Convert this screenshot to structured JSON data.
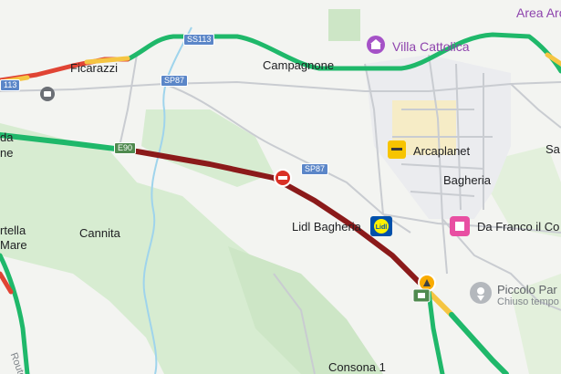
{
  "places": {
    "area_arco": "Area Arc",
    "villa_cattolica": "Villa Cattolica",
    "ficarazzi": "Ficarazzi",
    "campagnone": "Campagnone",
    "arcaplanet": "Arcaplanet",
    "bagheria": "Bagheria",
    "sa": "Sa",
    "cannita": "Cannita",
    "lidl": "Lidl Bagheria",
    "da_franco": "Da Franco il Co",
    "piccolo_par": "Piccolo Par",
    "chiuso": "Chiuso tempo",
    "consona": "Consona 1",
    "edge_top": "da",
    "edge_bottom": "ne",
    "rtella": "rtella",
    "mare": "Mare",
    "route_vertical": "Route"
  },
  "shields": {
    "ss113": "SS113",
    "sp87_top": "SP87",
    "sp87_mid": "SP87",
    "e90": "E90",
    "edge_113": "113"
  },
  "traffic": {
    "colors": {
      "free": "#1fb86a",
      "slow": "#f5c542",
      "jam": "#e04434",
      "heavy": "#8b1a1a"
    }
  },
  "icons": {
    "villa": "landmark-icon",
    "arcaplanet": "shop-icon",
    "lidl": "lidl-logo-icon",
    "da_franco": "restaurant-icon",
    "piccolo": "venue-icon",
    "incident_a": "incident-icon",
    "incident_b": "roadwork-icon",
    "camera": "camera-icon",
    "junction": "junction-icon"
  }
}
